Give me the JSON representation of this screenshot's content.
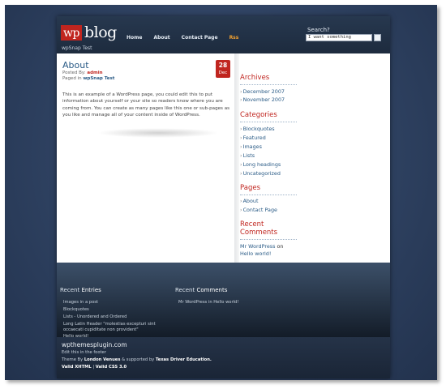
{
  "header": {
    "logo_wp": "wp",
    "logo_blog": "blog",
    "tagline": "wpSnap Test",
    "nav": [
      "Home",
      "About",
      "Contact Page",
      "Rss"
    ],
    "search_label": "Search?",
    "search_value": "I want something"
  },
  "post": {
    "title": "About",
    "posted_by_label": "Posted By:",
    "posted_by": "admin",
    "paged_in_label": "Paged in",
    "paged_in": "wpSnap Test",
    "date_day": "28",
    "date_month": "Dec",
    "body": "This is an example of a WordPress page, you could edit this to put information about yourself or your site so readers know where you are coming from. You can create as many pages like this one or sub-pages as you like and manage all of your content inside of WordPress."
  },
  "sidebar": {
    "archives_title": "Archives",
    "archives": [
      "December 2007",
      "November 2007"
    ],
    "categories_title": "Categories",
    "categories": [
      "Blockquotes",
      "Featured",
      "Images",
      "Lists",
      "Long headings",
      "Uncategorized"
    ],
    "pages_title": "Pages",
    "pages": [
      "About",
      "Contact Page"
    ],
    "recent_comments_title_1": "Recent",
    "recent_comments_title_2": "Comments",
    "comment_author": "Mr WordPress",
    "comment_on": "on",
    "comment_post": "Hello world!"
  },
  "recent_entries": {
    "title_1": "Recent",
    "title_2": "Entries",
    "items": [
      "Images in a post",
      "Blockquotes",
      "Lists - Unordered and Ordered",
      "Long Latin Header \"molestias excepturi sint",
      "occaecati cupiditate non provident\"",
      "Hello world!"
    ]
  },
  "recent_comments_footer": {
    "title_1": "Recent",
    "title_2": "Comments",
    "item": "Mr WordPress in Hello world!"
  },
  "footer": {
    "site": "wpthemesplugin.com",
    "edit": "Edit this in the footer",
    "theme_by": "Theme By",
    "theme_author": "London Venues",
    "supported_by": "& supported by",
    "supporter": "Texas Driver Education.",
    "valid_xhtml": "Valid XHTML",
    "sep": "|",
    "valid_css": "Valid CSS 3.0"
  }
}
